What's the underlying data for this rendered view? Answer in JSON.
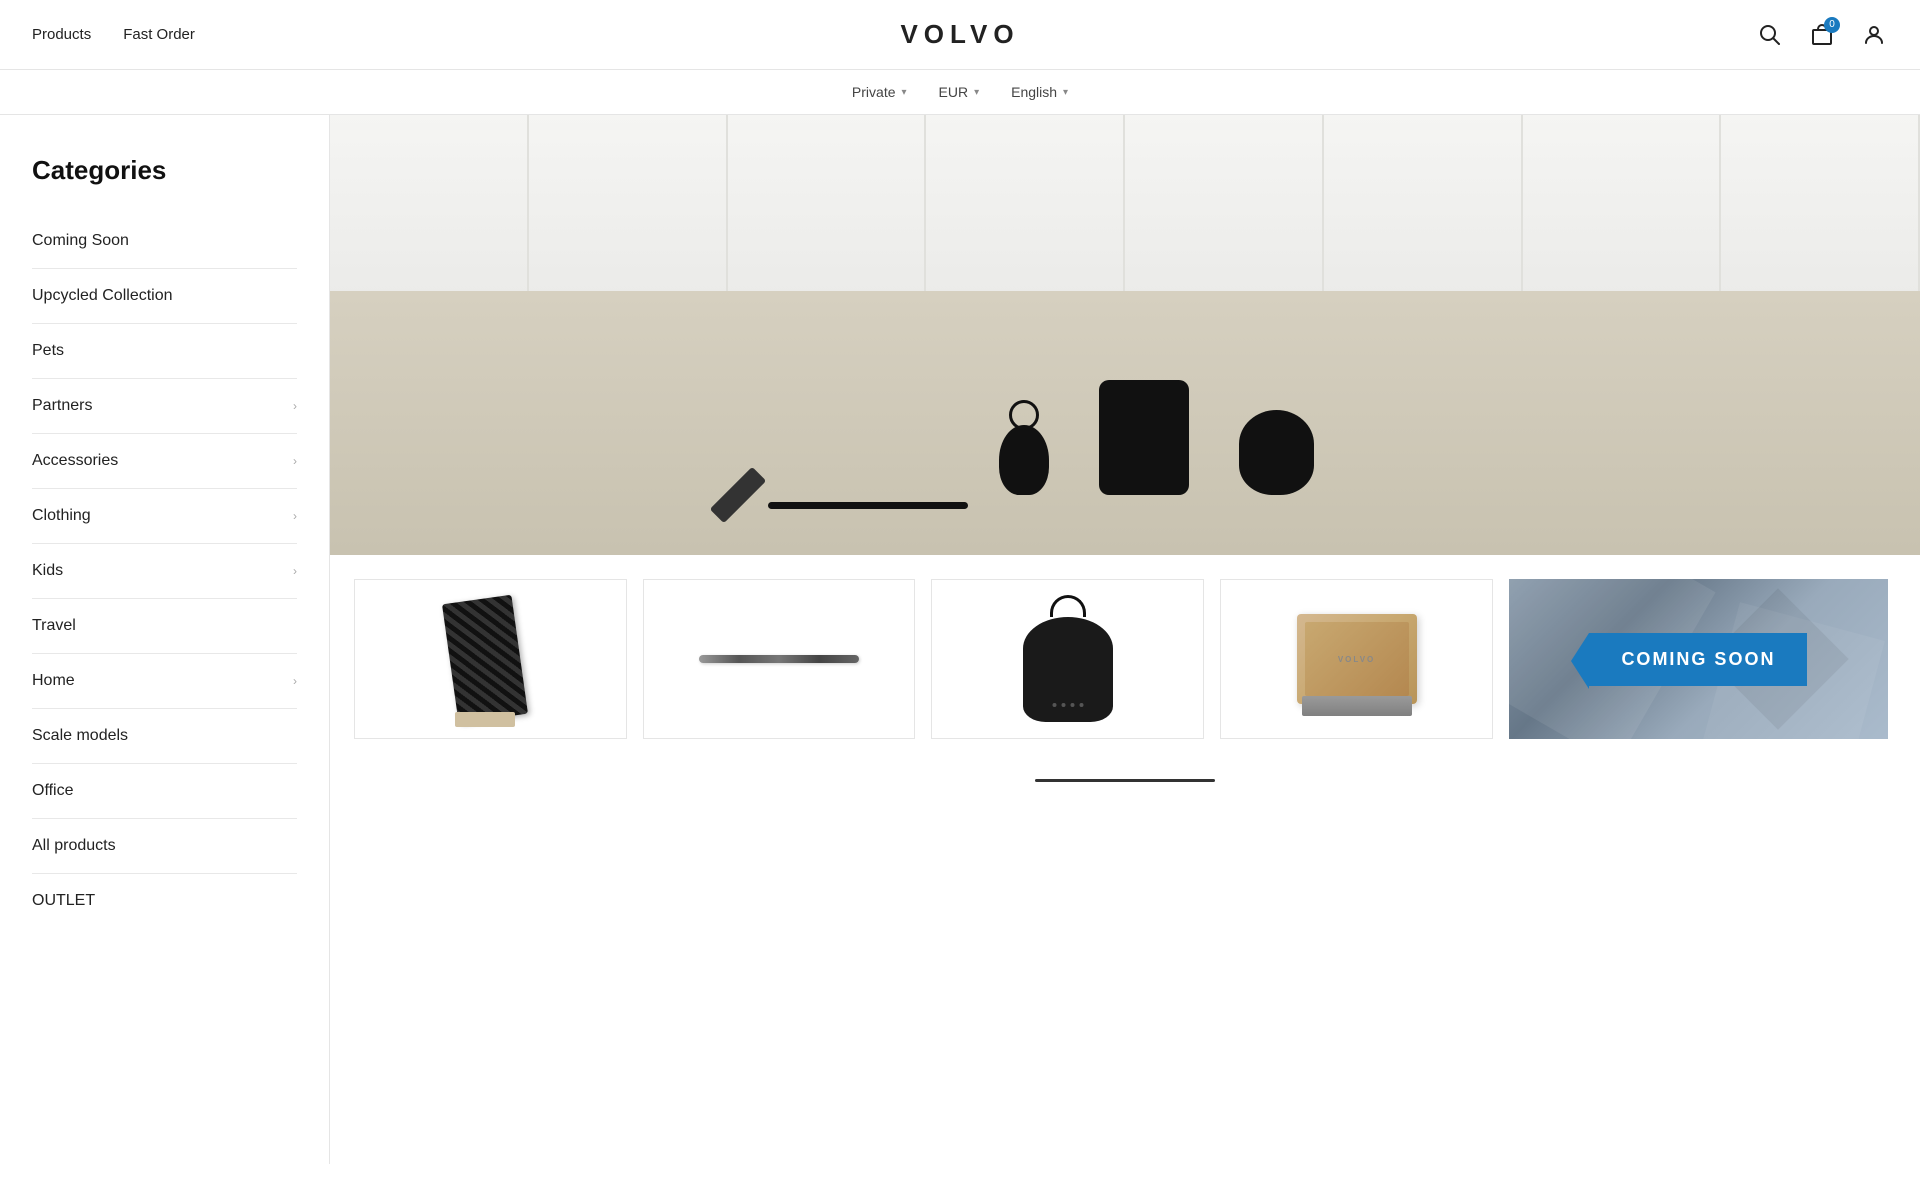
{
  "header": {
    "nav_left": [
      {
        "id": "products",
        "label": "Products"
      },
      {
        "id": "fast-order",
        "label": "Fast Order"
      }
    ],
    "logo": "VOLVO",
    "cart_count": "0"
  },
  "sub_header": {
    "items": [
      {
        "id": "private",
        "label": "Private",
        "has_chevron": true
      },
      {
        "id": "eur",
        "label": "EUR",
        "has_chevron": true
      },
      {
        "id": "english",
        "label": "English",
        "has_chevron": true
      }
    ]
  },
  "sidebar": {
    "title": "Categories",
    "items": [
      {
        "id": "coming-soon",
        "label": "Coming Soon",
        "has_chevron": false
      },
      {
        "id": "upcycled-collection",
        "label": "Upcycled Collection",
        "has_chevron": false
      },
      {
        "id": "pets",
        "label": "Pets",
        "has_chevron": false
      },
      {
        "id": "partners",
        "label": "Partners",
        "has_chevron": true
      },
      {
        "id": "accessories",
        "label": "Accessories",
        "has_chevron": true
      },
      {
        "id": "clothing",
        "label": "Clothing",
        "has_chevron": true
      },
      {
        "id": "kids",
        "label": "Kids",
        "has_chevron": true
      },
      {
        "id": "travel",
        "label": "Travel",
        "has_chevron": false
      },
      {
        "id": "home",
        "label": "Home",
        "has_chevron": true
      },
      {
        "id": "scale-models",
        "label": "Scale models",
        "has_chevron": false
      },
      {
        "id": "office",
        "label": "Office",
        "has_chevron": false
      },
      {
        "id": "all-products",
        "label": "All products",
        "has_chevron": false
      },
      {
        "id": "outlet",
        "label": "OUTLET",
        "has_chevron": false
      }
    ]
  },
  "product_cards": [
    {
      "id": "scarf",
      "type": "scarf"
    },
    {
      "id": "pen",
      "type": "pen"
    },
    {
      "id": "bag",
      "type": "bag"
    },
    {
      "id": "box",
      "type": "box"
    },
    {
      "id": "coming-soon-card",
      "type": "coming-soon",
      "label": "COMING SOON"
    }
  ],
  "coming_soon_label": "COMING SOON"
}
